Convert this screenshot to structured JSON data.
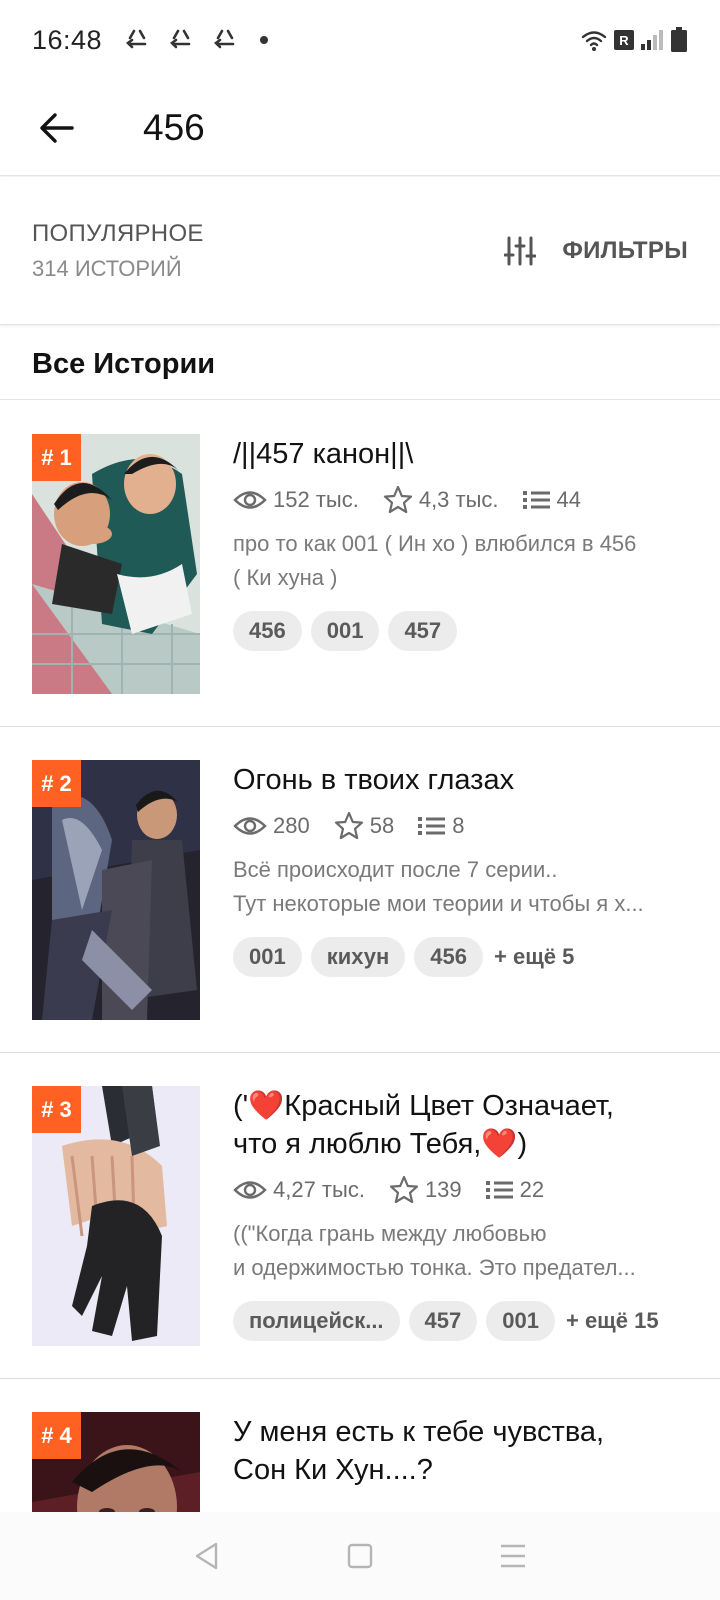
{
  "status_bar": {
    "time": "16:48",
    "notification_icons": [
      "recycle-icon",
      "recycle-icon",
      "recycle-icon"
    ],
    "network_badge": "R",
    "icons": [
      "wifi-icon",
      "signal-icon",
      "battery-icon"
    ]
  },
  "app_bar": {
    "title": "456",
    "back_icon": "arrow-left-icon"
  },
  "sort": {
    "label": "ПОПУЛЯРНОЕ",
    "count": "314 ИСТОРИЙ",
    "filters_label": "ФИЛЬТРЫ",
    "filters_icon": "sliders-icon"
  },
  "section": {
    "title": "Все Истории"
  },
  "stories": [
    {
      "rank": "# 1",
      "title_lines": [
        "/||457 канон||\\"
      ],
      "reads": "152 тыс.",
      "votes": "4,3 тыс.",
      "parts": "44",
      "desc_lines": [
        "про то как 001 ( Ин хо ) влюбился в 456",
        "( Ки хуна )"
      ],
      "tags": [
        "456",
        "001",
        "457"
      ],
      "more": ""
    },
    {
      "rank": "# 2",
      "title_lines": [
        "Огонь в твоих глазах"
      ],
      "reads": "280",
      "votes": "58",
      "parts": "8",
      "desc_lines": [
        "Всё происходит после 7 серии..",
        "Тут некоторые мои теории и чтобы я х..."
      ],
      "tags": [
        "001",
        "кихун",
        "456"
      ],
      "more": "+ ещё 5"
    },
    {
      "rank": "# 3",
      "title_lines": [
        "('❤️Красный Цвет Означает,",
        "что я люблю Тебя,❤️)"
      ],
      "reads": "4,27 тыс.",
      "votes": "139",
      "parts": "22",
      "desc_lines": [
        "((\"Когда грань между любовью",
        "и одержимостью тонка. Это предател..."
      ],
      "tags": [
        "полицейск...",
        "457",
        "001"
      ],
      "more": "+ ещё 15"
    },
    {
      "rank": "# 4",
      "title_lines": [
        "У меня есть к тебе чувства,",
        "Сон Ки Хун....?"
      ],
      "reads": "",
      "votes": "",
      "parts": "",
      "desc_lines": [],
      "tags": [],
      "more": ""
    }
  ],
  "nav_bar": {
    "icons": [
      "back-triangle-icon",
      "home-square-icon",
      "menu-lines-icon"
    ]
  },
  "colors": {
    "accent": "#ff6122",
    "text": "#121212",
    "muted": "#7a7a7a",
    "tag_bg": "#ececec"
  }
}
